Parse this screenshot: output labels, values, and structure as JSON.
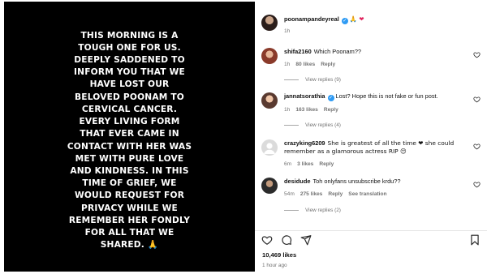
{
  "story_text": "THIS MORNING IS A\nTOUGH ONE FOR US.\nDEEPLY SADDENED TO\nINFORM YOU THAT WE\nHAVE LOST OUR\nBELOVED POONAM TO\nCERVICAL CANCER.\nEVERY LIVING FORM\nTHAT EVER CAME IN\nCONTACT WITH HER WAS\nMET WITH PURE LOVE\nAND KINDNESS. IN THIS\nTIME OF GRIEF, WE\nWOULD REQUEST FOR\nPRIVACY WHILE WE\nREMEMBER HER FONDLY\nFOR ALL THAT WE\nSHARED. 🙏",
  "caption": {
    "username": "poonampandeyreal",
    "emojis": "🙏 ❤",
    "time": "1h"
  },
  "comments": [
    {
      "username": "shifa2160",
      "verified": false,
      "text": "Which Poonam??",
      "time": "1h",
      "likes": "80 likes",
      "reply": "Reply",
      "view_replies": "View replies (9)"
    },
    {
      "username": "jannatsorathia",
      "verified": true,
      "text": "Lost? Hope this is not fake or fun post.",
      "time": "1h",
      "likes": "163 likes",
      "reply": "Reply",
      "view_replies": "View replies (4)"
    },
    {
      "username": "crazyking6209",
      "verified": false,
      "text": "She is greatest of all the time ❤ she could remember as a glamorous actress RIP 😔",
      "time": "6m",
      "likes": "3 likes",
      "reply": "Reply",
      "view_replies": ""
    },
    {
      "username": "desidude",
      "verified": false,
      "text": "Toh onlyfans unsubscribe krdu??",
      "time": "54m",
      "likes": "275 likes",
      "reply": "Reply",
      "see_translation": "See translation",
      "view_replies": "View replies (2)"
    }
  ],
  "likes_count": "10,469 likes",
  "posted_ago": "1 hour ago",
  "icons": {
    "like": "heart-icon",
    "comment": "comment-icon",
    "share": "share-icon",
    "save": "bookmark-icon",
    "verified": "verified-badge-icon"
  },
  "colors": {
    "media_bg": "#000000",
    "verified": "#2f9bf4",
    "heart_red": "#e0245e",
    "muted_text": "#737373"
  }
}
